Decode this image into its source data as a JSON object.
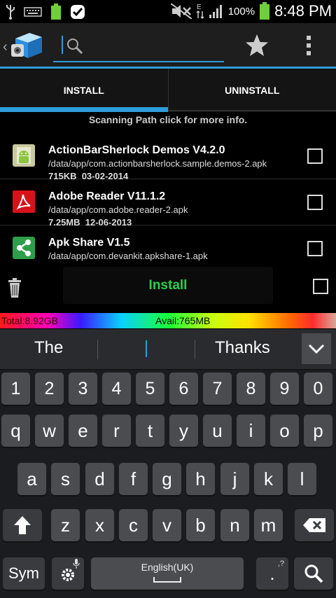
{
  "status_bar": {
    "battery_percent": "100%",
    "time": "8:48 PM"
  },
  "action_bar": {
    "search": {
      "placeholder": ""
    }
  },
  "tabs": [
    {
      "label": "INSTALL",
      "selected": true
    },
    {
      "label": "UNINSTALL",
      "selected": false
    }
  ],
  "scan_text": "Scanning Path click for more info.",
  "apps": [
    {
      "title": "ActionBarSherlock Demos V4.2.0",
      "path": "/data/app/com.actionbarsherlock.sample.demos-2.apk",
      "size": "715KB",
      "date": "03-02-2014",
      "icon": "android-icon",
      "checked": false
    },
    {
      "title": "Adobe Reader V11.1.2",
      "path": "/data/app/com.adobe.reader-2.apk",
      "size": "7.25MB",
      "date": "12-06-2013",
      "icon": "adobe-reader-icon",
      "checked": false
    },
    {
      "title": "Apk Share V1.5",
      "path": "/data/app/com.devankit.apkshare-1.apk",
      "size": "",
      "date": "",
      "icon": "share-icon",
      "checked": false
    }
  ],
  "actions": {
    "install_label": "Install"
  },
  "storage": {
    "total": "Total:8.92GB",
    "avail": "Avail:765MB"
  },
  "suggestions": {
    "left": "The",
    "right": "Thanks"
  },
  "keyboard": {
    "row1": [
      "1",
      "2",
      "3",
      "4",
      "5",
      "6",
      "7",
      "8",
      "9",
      "0"
    ],
    "row2": [
      "q",
      "w",
      "e",
      "r",
      "t",
      "y",
      "u",
      "i",
      "o",
      "p"
    ],
    "row3": [
      "a",
      "s",
      "d",
      "f",
      "g",
      "h",
      "j",
      "k",
      "l"
    ],
    "row4": [
      "z",
      "x",
      "c",
      "v",
      "b",
      "n",
      "m"
    ],
    "sym_label": "Sym",
    "space_label": "English(UK)",
    "period_label": ".",
    "period_hint": ",?"
  },
  "colors": {
    "accent": "#2d9cdb",
    "install_text": "#29d14a"
  }
}
